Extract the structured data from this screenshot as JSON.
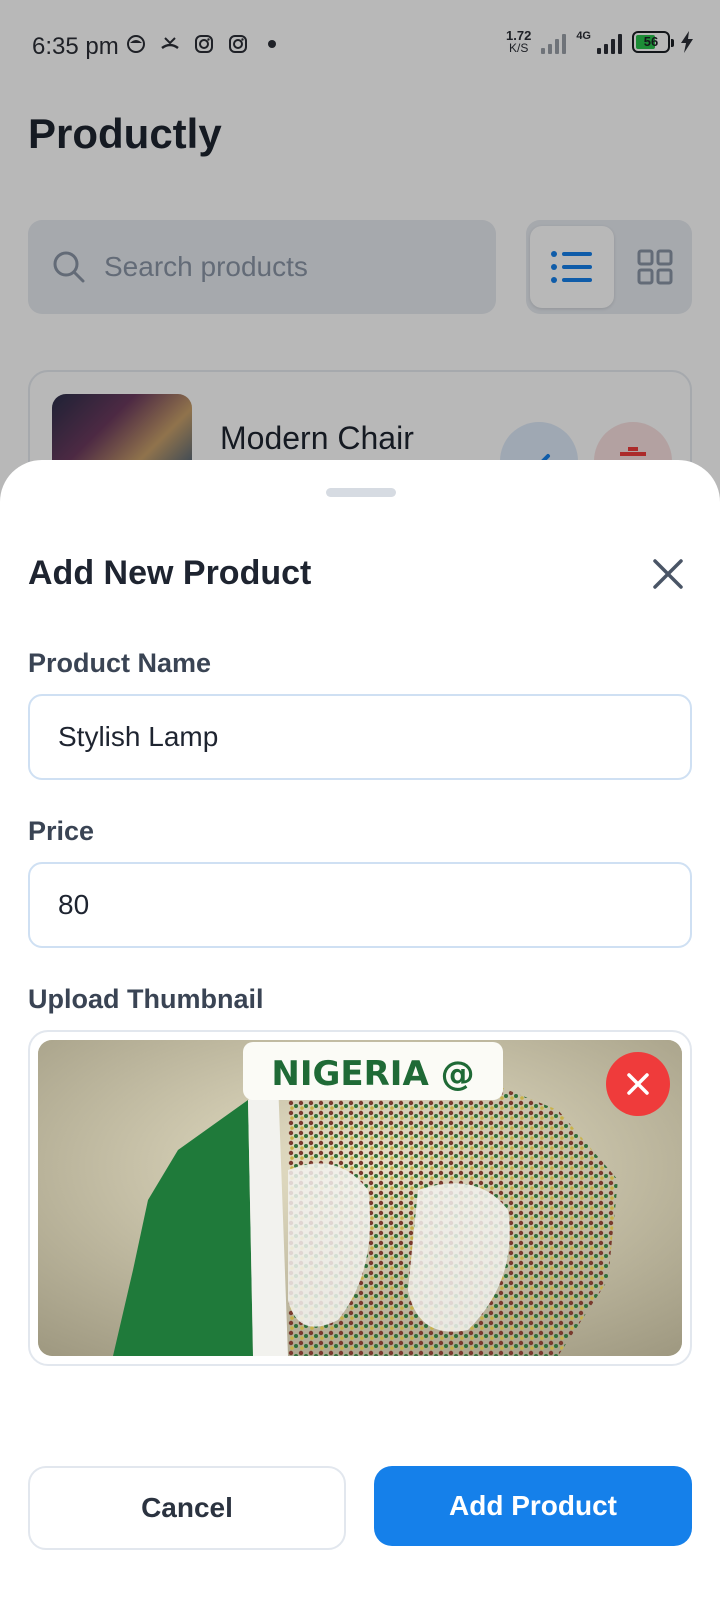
{
  "status_bar": {
    "time": "6:35 pm",
    "net_speed_value": "1.72",
    "net_speed_unit": "K/S",
    "network_type": "4G",
    "battery_percent": "56",
    "icons": [
      "face-icon",
      "missed-call-icon",
      "instagram-icon",
      "instagram-icon",
      "dot-icon",
      "signal-icon",
      "signal-4g-icon",
      "battery-icon",
      "charging-icon"
    ]
  },
  "app": {
    "title": "Productly",
    "search_placeholder": "Search products",
    "view_modes": [
      "list",
      "grid"
    ],
    "active_view": "list"
  },
  "product_list": [
    {
      "name": "Modern Chair"
    }
  ],
  "sheet": {
    "title": "Add New Product",
    "name_label": "Product Name",
    "name_value": "Stylish Lamp",
    "price_label": "Price",
    "price_value": "80",
    "thumbnail_label": "Upload Thumbnail",
    "thumbnail_caption": "NIGERIA @",
    "cancel_label": "Cancel",
    "submit_label": "Add Product"
  },
  "colors": {
    "primary": "#1580ea",
    "danger": "#ef3b3b",
    "text_dark": "#1e2430",
    "field_border": "#cfe0f3"
  }
}
